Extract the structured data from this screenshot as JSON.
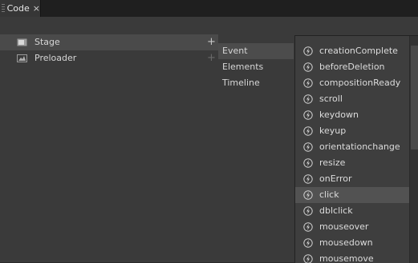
{
  "tab": {
    "title": "Code",
    "close": "×"
  },
  "tree": [
    {
      "label": "Stage",
      "icon": "stage-icon",
      "selected": true
    },
    {
      "label": "Preloader",
      "icon": "preloader-icon",
      "selected": false
    }
  ],
  "plus_glyph": "+",
  "submenu": [
    {
      "label": "Event",
      "selected": true
    },
    {
      "label": "Elements",
      "selected": false
    },
    {
      "label": "Timeline",
      "selected": false
    }
  ],
  "events": [
    {
      "label": "creationComplete",
      "selected": false
    },
    {
      "label": "beforeDeletion",
      "selected": false
    },
    {
      "label": "compositionReady",
      "selected": false
    },
    {
      "label": "scroll",
      "selected": false
    },
    {
      "label": "keydown",
      "selected": false
    },
    {
      "label": "keyup",
      "selected": false
    },
    {
      "label": "orientationchange",
      "selected": false
    },
    {
      "label": "resize",
      "selected": false
    },
    {
      "label": "onError",
      "selected": false
    },
    {
      "label": "click",
      "selected": true
    },
    {
      "label": "dblclick",
      "selected": false
    },
    {
      "label": "mouseover",
      "selected": false
    },
    {
      "label": "mousedown",
      "selected": false
    },
    {
      "label": "mousemove",
      "selected": false
    }
  ],
  "colors": {
    "panel": "#3a3a3a",
    "selected": "#4a4a4a",
    "popup": "#3e3e3e"
  }
}
